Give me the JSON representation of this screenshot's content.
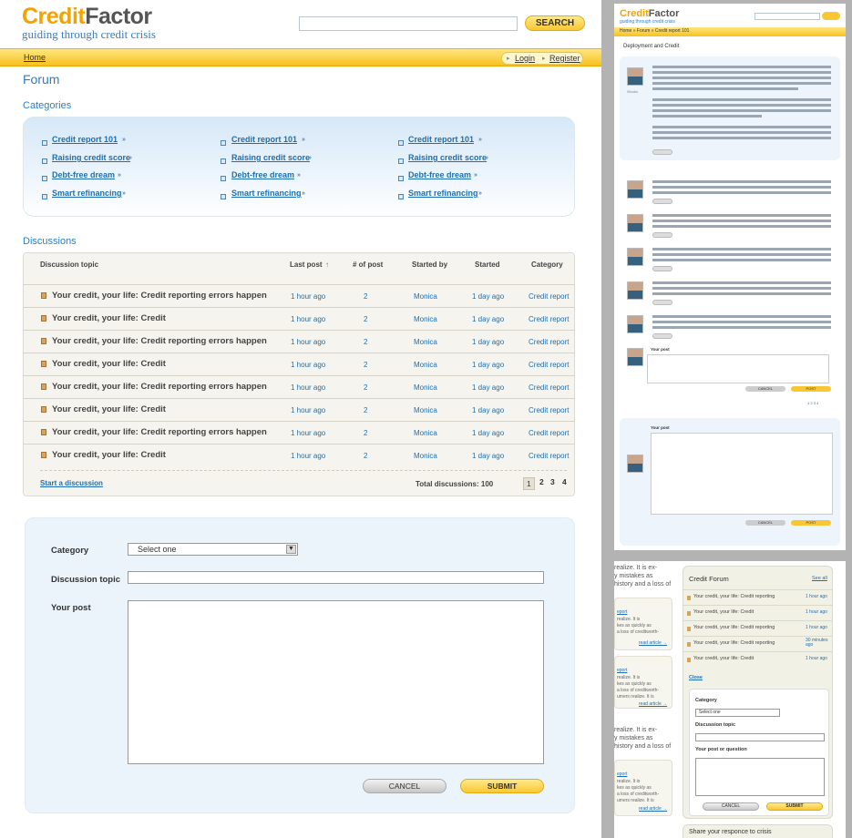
{
  "brand": {
    "name_part1": "Credit",
    "name_part2": "Factor",
    "tagline": "guiding through credit crisis"
  },
  "search": {
    "button": "SEARCH"
  },
  "nav": {
    "home": "Home",
    "login": "Login",
    "register": "Register"
  },
  "page": {
    "title": "Forum",
    "categories_heading": "Categories",
    "discussions_heading": "Discussions"
  },
  "categories": {
    "col1": [
      "Credit report 101",
      "Raising credit score",
      "Debt-free dream",
      "Smart refinancing"
    ],
    "col2": [
      "Credit report 101",
      "Raising credit score",
      "Debt-free dream",
      "Smart refinancing"
    ],
    "col3": [
      "Credit report 101",
      "Raising credit score",
      "Debt-free dream",
      "Smart refinancing"
    ],
    "arrow": "»"
  },
  "table": {
    "headers": {
      "topic": "Discussion topic",
      "last_post": "Last post",
      "sort_icon": "↑",
      "num_posts": "# of post",
      "started_by": "Started by",
      "started": "Started",
      "category": "Category"
    },
    "rows": [
      {
        "topic": "Your credit, your life: Credit reporting errors happen",
        "last_post": "1 hour ago",
        "posts": "2",
        "by": "Monica",
        "started": "1 day ago",
        "category": "Credit report"
      },
      {
        "topic": "Your credit, your life: Credit",
        "last_post": "1 hour ago",
        "posts": "2",
        "by": "Monica",
        "started": "1 day ago",
        "category": "Credit report"
      },
      {
        "topic": "Your credit, your life: Credit reporting errors happen",
        "last_post": "1 hour ago",
        "posts": "2",
        "by": "Monica",
        "started": "1 day ago",
        "category": "Credit report"
      },
      {
        "topic": "Your credit, your life: Credit",
        "last_post": "1 hour ago",
        "posts": "2",
        "by": "Monica",
        "started": "1 day ago",
        "category": "Credit report"
      },
      {
        "topic": "Your credit, your life: Credit reporting errors happen",
        "last_post": "1 hour ago",
        "posts": "2",
        "by": "Monica",
        "started": "1 day ago",
        "category": "Credit report"
      },
      {
        "topic": "Your credit, your life: Credit",
        "last_post": "1 hour ago",
        "posts": "2",
        "by": "Monica",
        "started": "1 day ago",
        "category": "Credit report"
      },
      {
        "topic": "Your credit, your life: Credit reporting errors happen",
        "last_post": "1 hour ago",
        "posts": "2",
        "by": "Monica",
        "started": "1 day ago",
        "category": "Credit report"
      },
      {
        "topic": "Your credit, your life: Credit",
        "last_post": "1 hour ago",
        "posts": "2",
        "by": "Monica",
        "started": "1 day ago",
        "category": "Credit report"
      }
    ],
    "start_discussion": "Start a discussion",
    "total": "Total discussions: 100",
    "pages": [
      "1",
      "2",
      "3",
      "4"
    ]
  },
  "form": {
    "category_label": "Category",
    "category_value": "Select one",
    "topic_label": "Discussion topic",
    "post_label": "Your post",
    "cancel": "CANCEL",
    "submit": "SUBMIT"
  },
  "mockup_top": {
    "brand_part1": "Credit",
    "brand_part2": "Factor",
    "tagline": "guiding through credit crisis",
    "breadcrumb": "Home » Forum » Credit report 101",
    "title": "Deployment and Credit",
    "avatar_label": "iStudio",
    "cancel": "CANCEL",
    "post": "POST",
    "your_post": "Your post",
    "pages": "1 2 3 4"
  },
  "mockup_bottom": {
    "card_texts": [
      "realize. It is ex-",
      "y mistakes as",
      "history and a loss of"
    ],
    "card_small": [
      "eport",
      "realize. It is",
      "kes as quickly as",
      "a loss of creditworth-",
      "umers realize. It is"
    ],
    "read_article": "read article →",
    "card_texts2": [
      "realize. It is ex-",
      "y mistakes as",
      "history and a loss of"
    ],
    "panel_title": "Credit Forum",
    "see_all": "See all",
    "rows": [
      {
        "text": "Your credit, your life: Credit reporting",
        "time": "1 hour ago"
      },
      {
        "text": "Your credit, your life: Credit",
        "time": "1 hour ago"
      },
      {
        "text": "Your credit, your life: Credit reporting",
        "time": "1 hour ago"
      },
      {
        "text": "Your credit, your life: Credit reporting",
        "time": "30 minutes ago"
      },
      {
        "text": "Your credit, your life: Credit",
        "time": "1 hour ago"
      }
    ],
    "close": "Close",
    "category": "Category",
    "select_value": "Select one",
    "topic": "Discussion topic",
    "post_or_question": "Your post or question",
    "cancel": "CANCEL",
    "submit": "SUBMIT",
    "share": "Share your responce to crisis"
  },
  "colors": {
    "accent_blue": "#2a7fc4",
    "brand_orange": "#f5a200",
    "nav_yellow": "#f6c11e",
    "panel_blue": "#ecf4fb"
  }
}
